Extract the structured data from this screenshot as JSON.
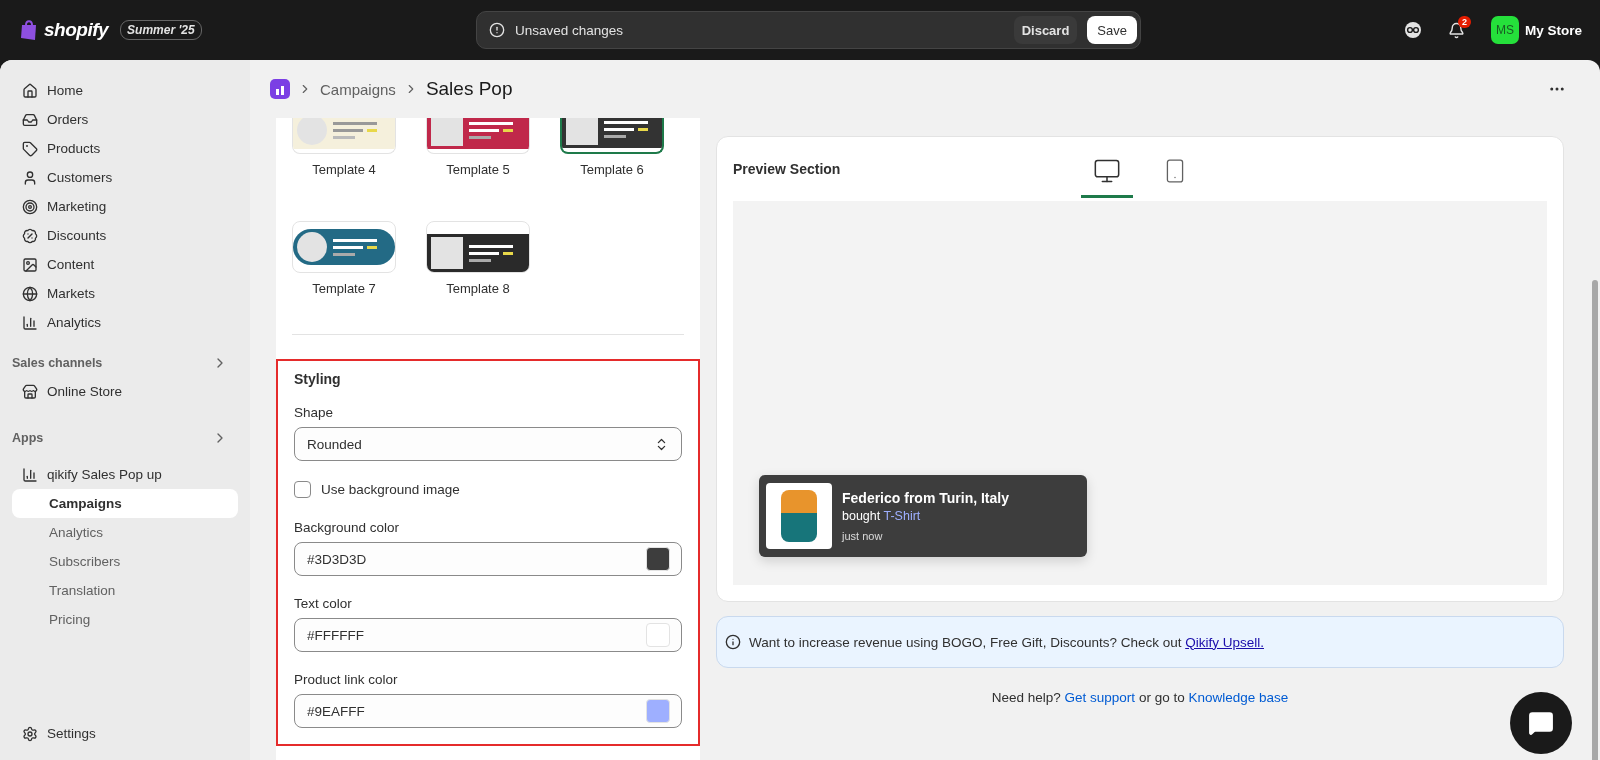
{
  "topbar": {
    "brand": "shopify",
    "edition": "Summer '25",
    "unsaved": "Unsaved changes",
    "discard": "Discard",
    "save": "Save",
    "notifications": "2",
    "avatar": "MS",
    "store": "My Store"
  },
  "sidebar": {
    "items": [
      {
        "label": "Home",
        "selected": false
      },
      {
        "label": "Orders",
        "selected": false
      },
      {
        "label": "Products",
        "selected": false
      },
      {
        "label": "Customers",
        "selected": false
      },
      {
        "label": "Marketing",
        "selected": false
      },
      {
        "label": "Discounts",
        "selected": false
      },
      {
        "label": "Content",
        "selected": false
      },
      {
        "label": "Markets",
        "selected": false
      },
      {
        "label": "Analytics",
        "selected": false
      }
    ],
    "sales_channels": {
      "title": "Sales channels",
      "items": [
        {
          "label": "Online Store",
          "selected": false
        }
      ]
    },
    "apps": {
      "title": "Apps",
      "app": {
        "label": "qikify Sales Pop up",
        "children": [
          {
            "label": "Campaigns",
            "selected": true
          },
          {
            "label": "Analytics",
            "selected": false
          },
          {
            "label": "Subscribers",
            "selected": false
          },
          {
            "label": "Translation",
            "selected": false
          },
          {
            "label": "Pricing",
            "selected": false
          }
        ]
      }
    },
    "settings": "Settings"
  },
  "breadcrumb": {
    "parent": "Campaigns",
    "current": "Sales Pop"
  },
  "templates": [
    {
      "label": "Template 4",
      "selected": false,
      "kind": "circle",
      "color": "#f5f0dc"
    },
    {
      "label": "Template 5",
      "selected": false,
      "kind": "square",
      "color": "#c0284a"
    },
    {
      "label": "Template 6",
      "selected": true,
      "kind": "square",
      "color": "#333333"
    },
    {
      "label": "Template 7",
      "selected": false,
      "kind": "pill",
      "color": "#236a85"
    },
    {
      "label": "Template 8",
      "selected": false,
      "kind": "square",
      "color": "#2a2a2a"
    }
  ],
  "styling": {
    "title": "Styling",
    "shape": {
      "label": "Shape",
      "value": "Rounded"
    },
    "background_image": {
      "label": "Use background image",
      "checked": false
    },
    "colors": [
      {
        "label": "Background color",
        "value": "#3D3D3D",
        "color": "#3d3d3d"
      },
      {
        "label": "Text color",
        "value": "#FFFFFF",
        "color": "#ffffff"
      },
      {
        "label": "Product link color",
        "value": "#9EAFFF",
        "color": "#9eafff"
      }
    ]
  },
  "preview": {
    "title": "Preview Section",
    "devices": [
      {
        "kind": "desktop",
        "selected": true
      },
      {
        "kind": "mobile",
        "selected": false
      }
    ],
    "popup": {
      "title": "Federico from Turin, Italy",
      "verb": "bought",
      "product": "T-Shirt",
      "time": "just now"
    }
  },
  "banner": {
    "text": "Want to increase revenue using BOGO, Free Gift, Discounts? Check out",
    "link": "Qikify Upsell."
  },
  "help": {
    "prefix": "Need help?",
    "support": "Get support",
    "middle": "or go to",
    "knowledge": "Knowledge base"
  }
}
